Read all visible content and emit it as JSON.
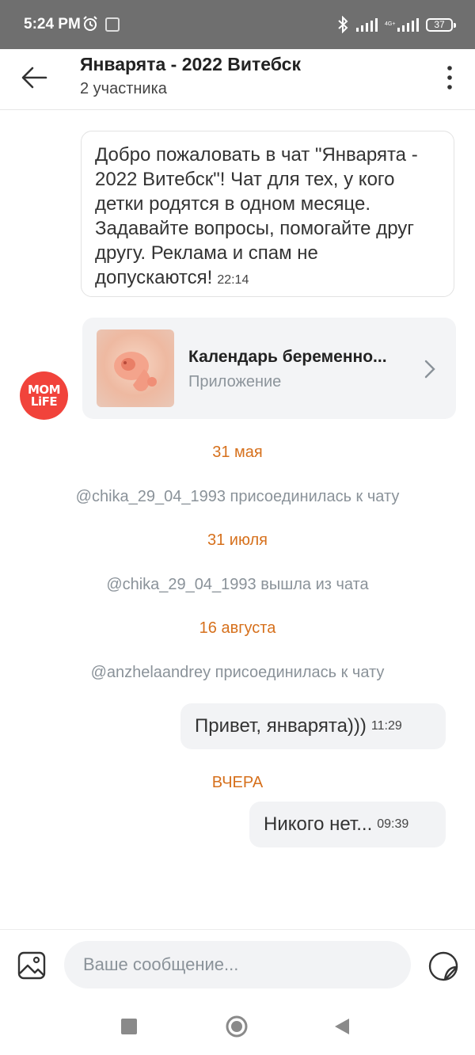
{
  "status_bar": {
    "time": "5:24 PM",
    "network": "4G+",
    "battery": "37"
  },
  "header": {
    "title": "Январята - 2022 Витебск",
    "subtitle": "2 участника"
  },
  "messages": {
    "welcome": {
      "text": "Добро пожаловать в чат \"Январята - 2022 Витебск\"! Чат для тех, у кого детки родятся в одном месяце. Задавайте вопросы, помогайте друг другу. Реклама и спам не допускаются!",
      "time": "22:14"
    },
    "avatar": {
      "line1": "MOM",
      "line2": "LiFE"
    },
    "app_card": {
      "title": "Календарь беременно...",
      "subtitle": "Приложение"
    },
    "date1": "31 мая",
    "system1": "@chika_29_04_1993 присоединилась к чату",
    "date2": "31 июля",
    "system2": "@chika_29_04_1993 вышла из чата",
    "date3": "16 августа",
    "system3": "@anzhelaandrey присоединилась к чату",
    "out1": {
      "text": "Привет, январята)))",
      "time": "11:29"
    },
    "date4": "ВЧЕРА",
    "out2": {
      "text": "Никого нет...",
      "time": "09:39"
    }
  },
  "input": {
    "placeholder": "Ваше сообщение..."
  },
  "icons": {
    "back": "arrow-left-icon",
    "menu": "more-vertical-icon",
    "gallery": "image-icon",
    "sticker": "sticker-icon"
  },
  "colors": {
    "date_accent": "#d6701c",
    "system_text": "#8a9299",
    "avatar": "#f1433b"
  }
}
